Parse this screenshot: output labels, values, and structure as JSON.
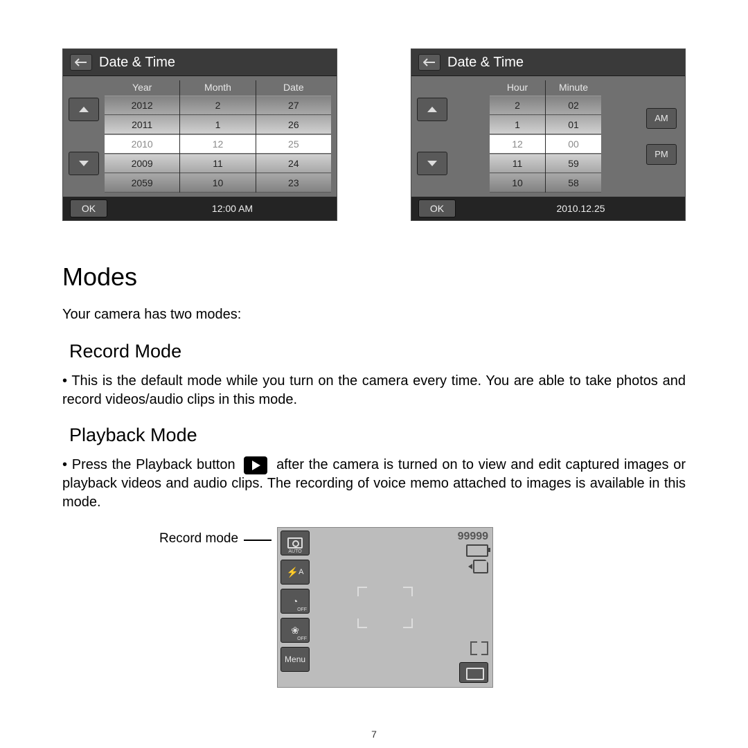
{
  "dateScreen": {
    "title": "Date & Time",
    "cols": [
      "Year",
      "Month",
      "Date"
    ],
    "year": [
      "2012",
      "2011",
      "2010",
      "2009",
      "2059"
    ],
    "month": [
      "2",
      "1",
      "12",
      "11",
      "10"
    ],
    "date": [
      "27",
      "26",
      "25",
      "24",
      "23"
    ],
    "ok": "OK",
    "stamp": "12:00 AM"
  },
  "timeScreen": {
    "title": "Date & Time",
    "cols": [
      "Hour",
      "Minute"
    ],
    "hour": [
      "2",
      "1",
      "12",
      "11",
      "10"
    ],
    "minute": [
      "02",
      "01",
      "00",
      "59",
      "58"
    ],
    "am": "AM",
    "pm": "PM",
    "ok": "OK",
    "stamp": "2010.12.25"
  },
  "text": {
    "modes": "Modes",
    "intro": "Your camera has two modes:",
    "record_h": "Record Mode",
    "record_p": "This is the default mode while you turn on the camera every time. You are able to take photos and record videos/audio clips in this mode.",
    "playback_h": "Playback Mode",
    "playback_pre": "Press the ",
    "playback_btn": "Playback button",
    "playback_post": " after the camera is turned on to view and edit captured images or playback videos and audio clips. The recording of voice memo attached to images is available in this mode.",
    "fig_label": "Record mode"
  },
  "recScreen": {
    "auto": "AUTO",
    "flash": "A",
    "timer_off": "OFF",
    "macro_off": "OFF",
    "menu": "Menu",
    "counter": "99999"
  },
  "pagenum": "7"
}
